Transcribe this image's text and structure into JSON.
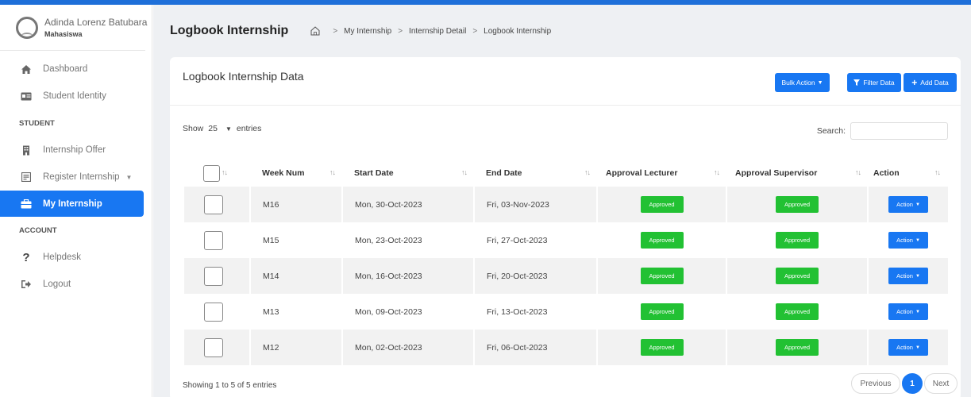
{
  "profile": {
    "name": "Adinda Lorenz Batubara",
    "role": "Mahasiswa"
  },
  "sidebar": {
    "items": [
      {
        "label": "Dashboard",
        "icon": "home-icon"
      },
      {
        "label": "Student Identity",
        "icon": "id-card-icon"
      }
    ],
    "section_student": "STUDENT",
    "student_items": [
      {
        "label": "Internship Offer",
        "icon": "building-icon"
      },
      {
        "label": "Register Internship",
        "icon": "form-icon"
      },
      {
        "label": "My Internship",
        "icon": "briefcase-icon"
      }
    ],
    "section_account": "ACCOUNT",
    "account_items": [
      {
        "label": "Helpdesk",
        "icon": "question-icon"
      },
      {
        "label": "Logout",
        "icon": "logout-icon"
      }
    ]
  },
  "header": {
    "title": "Logbook Internship",
    "breadcrumb": [
      "My Internship",
      "Internship Detail",
      "Logbook Internship"
    ]
  },
  "card": {
    "title": "Logbook Internship Data",
    "bulk_action": "Bulk Action",
    "filter_data": "Filter Data",
    "add_data": "Add Data",
    "show_label": "Show",
    "entries_value": "25",
    "entries_label": "entries",
    "search_label": "Search:",
    "search_value": ""
  },
  "table": {
    "columns": [
      "Week Num",
      "Start Date",
      "End Date",
      "Approval Lecturer",
      "Approval Supervisor",
      "Action"
    ],
    "rows": [
      {
        "week": "M16",
        "start": "Mon, 30-Oct-2023",
        "end": "Fri, 03-Nov-2023",
        "lecturer": "Approved",
        "supervisor": "Approved",
        "action": "Action"
      },
      {
        "week": "M15",
        "start": "Mon, 23-Oct-2023",
        "end": "Fri, 27-Oct-2023",
        "lecturer": "Approved",
        "supervisor": "Approved",
        "action": "Action"
      },
      {
        "week": "M14",
        "start": "Mon, 16-Oct-2023",
        "end": "Fri, 20-Oct-2023",
        "lecturer": "Approved",
        "supervisor": "Approved",
        "action": "Action"
      },
      {
        "week": "M13",
        "start": "Mon, 09-Oct-2023",
        "end": "Fri, 13-Oct-2023",
        "lecturer": "Approved",
        "supervisor": "Approved",
        "action": "Action"
      },
      {
        "week": "M12",
        "start": "Mon, 02-Oct-2023",
        "end": "Fri, 06-Oct-2023",
        "lecturer": "Approved",
        "supervisor": "Approved",
        "action": "Action"
      }
    ]
  },
  "footer": {
    "info": "Showing 1 to 5 of 5 entries",
    "previous": "Previous",
    "current_page": "1",
    "next": "Next"
  },
  "colors": {
    "primary": "#1877f2",
    "approved": "#22c133",
    "background": "#eef0f3"
  }
}
